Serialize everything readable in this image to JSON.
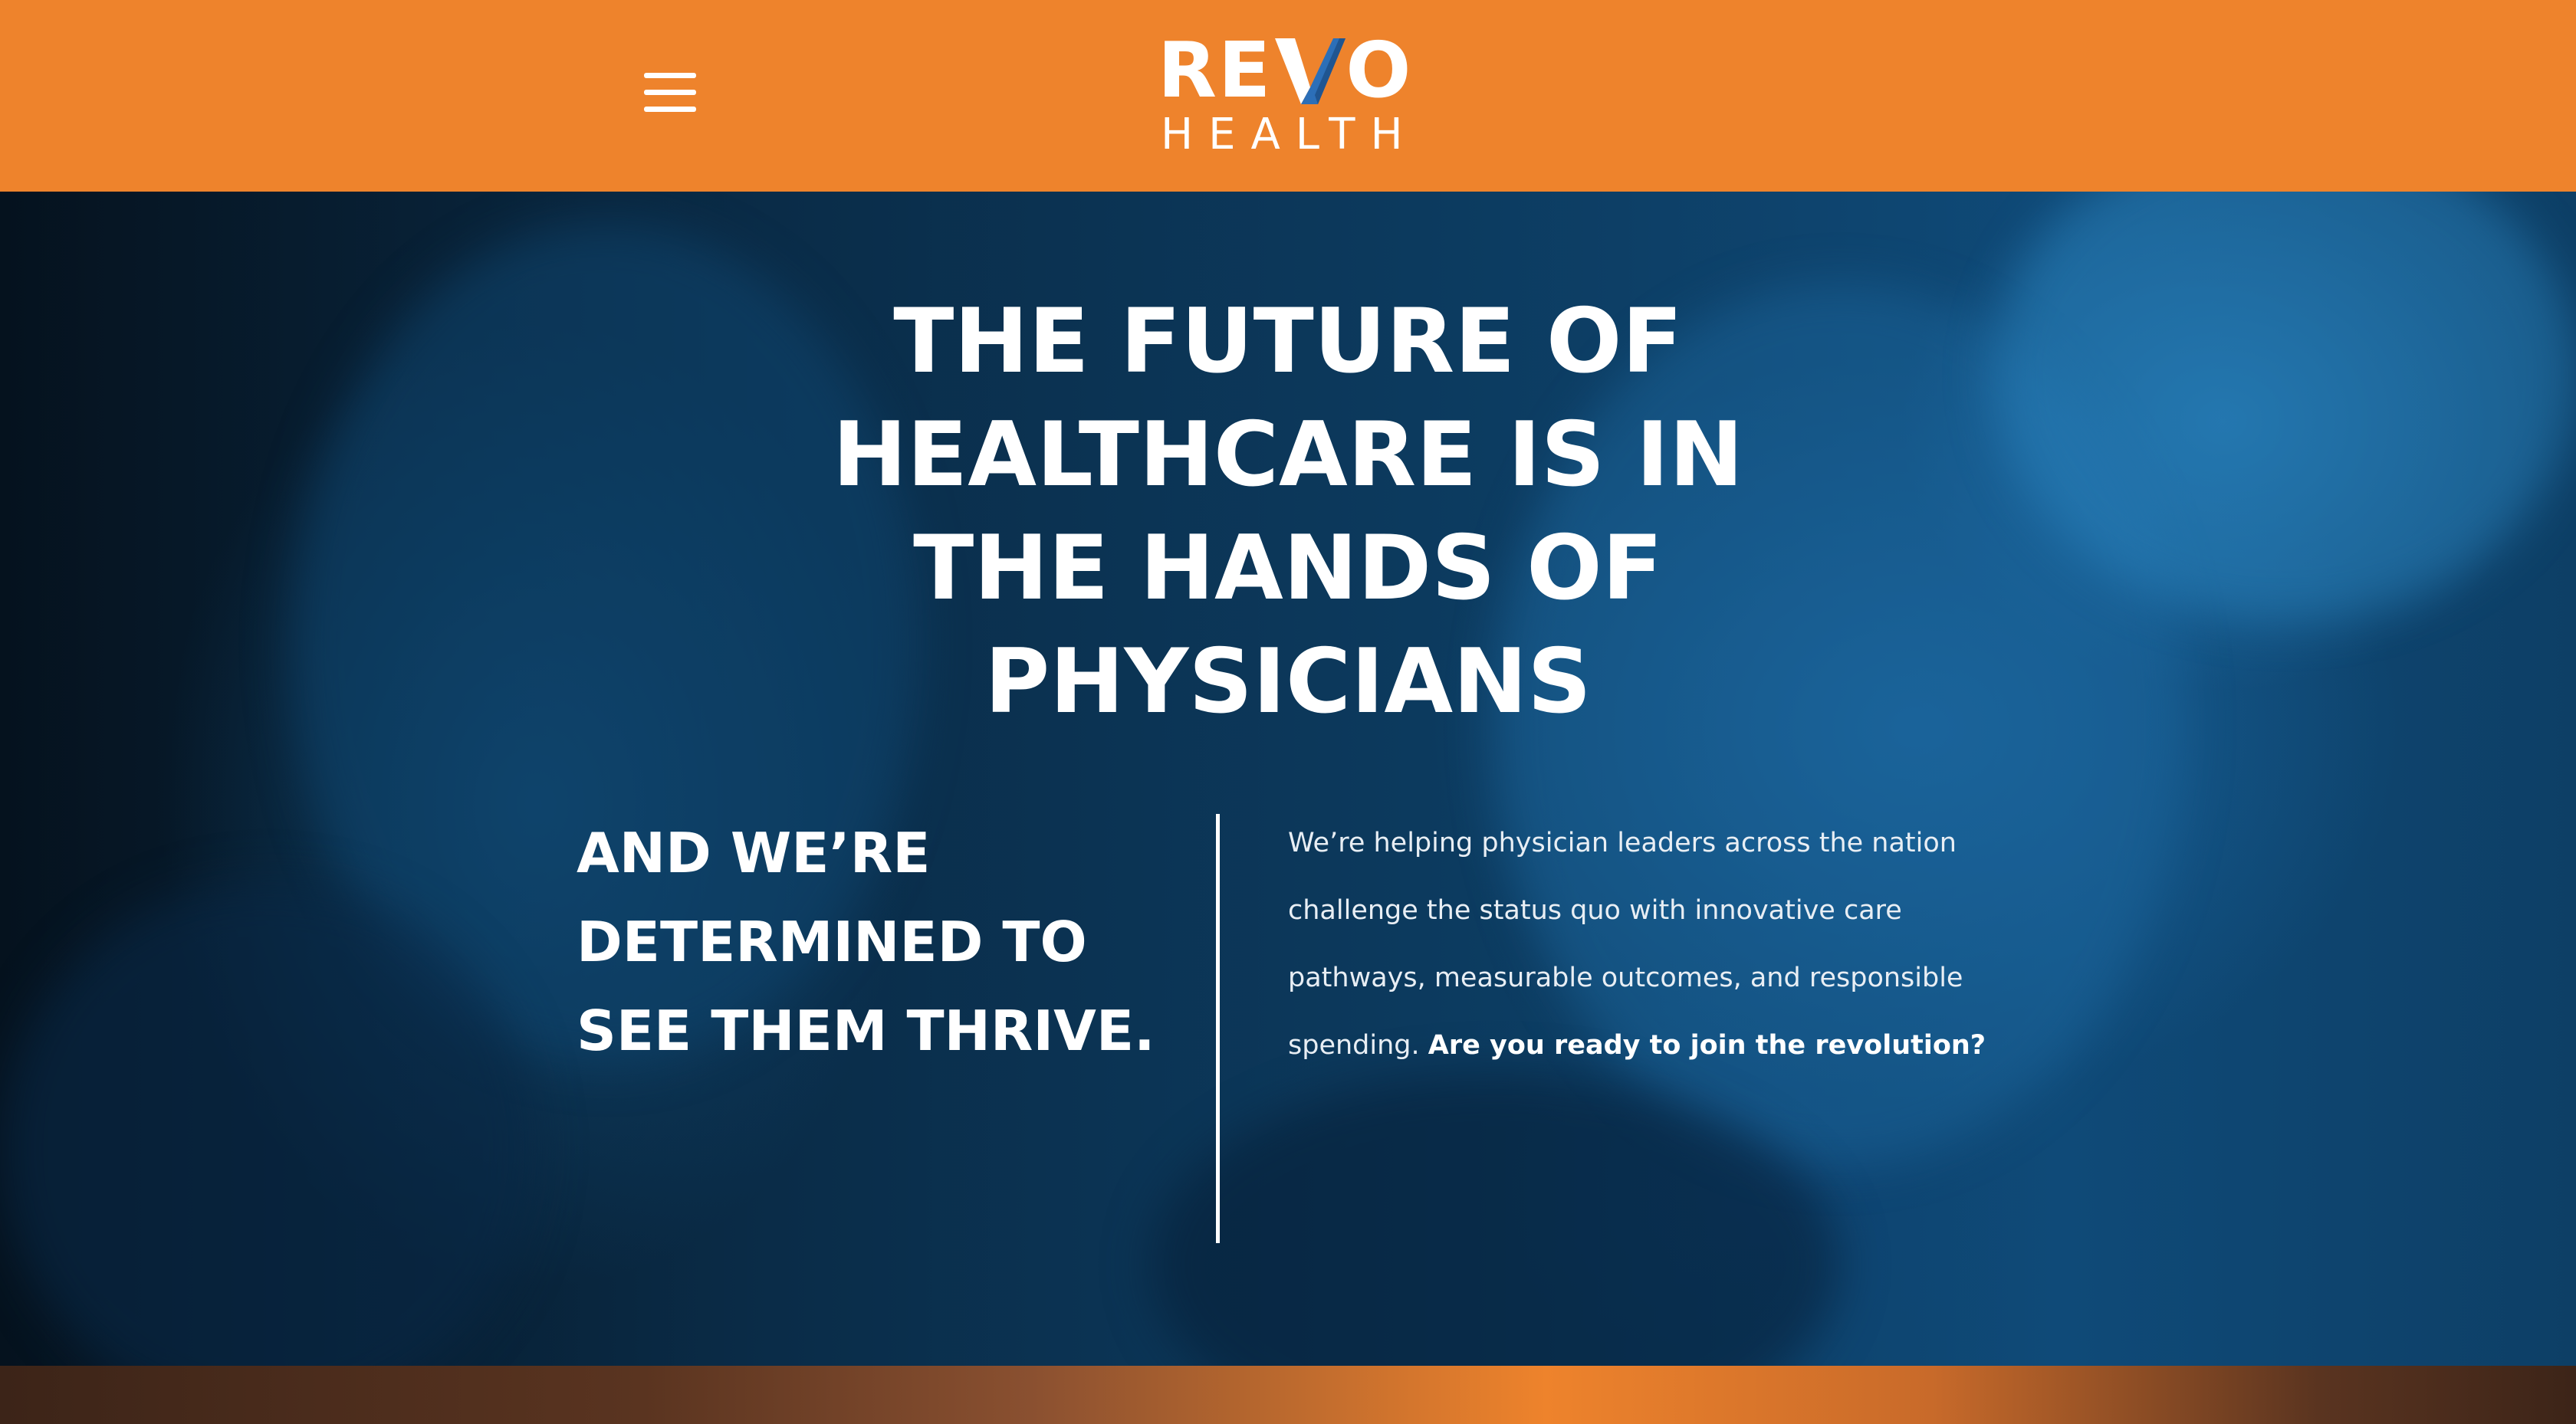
{
  "header": {
    "menu_icon": "hamburger-menu-icon",
    "logo": {
      "word_left": "RE",
      "word_right": "O",
      "sub": "HEALTH"
    }
  },
  "hero": {
    "headline_lines": [
      "THE FUTURE OF",
      "HEALTHCARE IS IN",
      "THE HANDS OF",
      "PHYSICIANS"
    ],
    "subhead_lines": [
      "AND WE’RE",
      "DETERMINED TO",
      "SEE THEM THRIVE."
    ],
    "body_lines": [
      "We’re helping physician leaders across the nation",
      "challenge the status quo with innovative care",
      "pathways, measurable outcomes, and responsible"
    ],
    "body_last_plain": "spending. ",
    "body_cta": "Are you ready to join the revolution?"
  },
  "colors": {
    "brand_orange": "#ee832c",
    "logo_blue": "#2c6fb8",
    "text_white": "#ffffff"
  }
}
